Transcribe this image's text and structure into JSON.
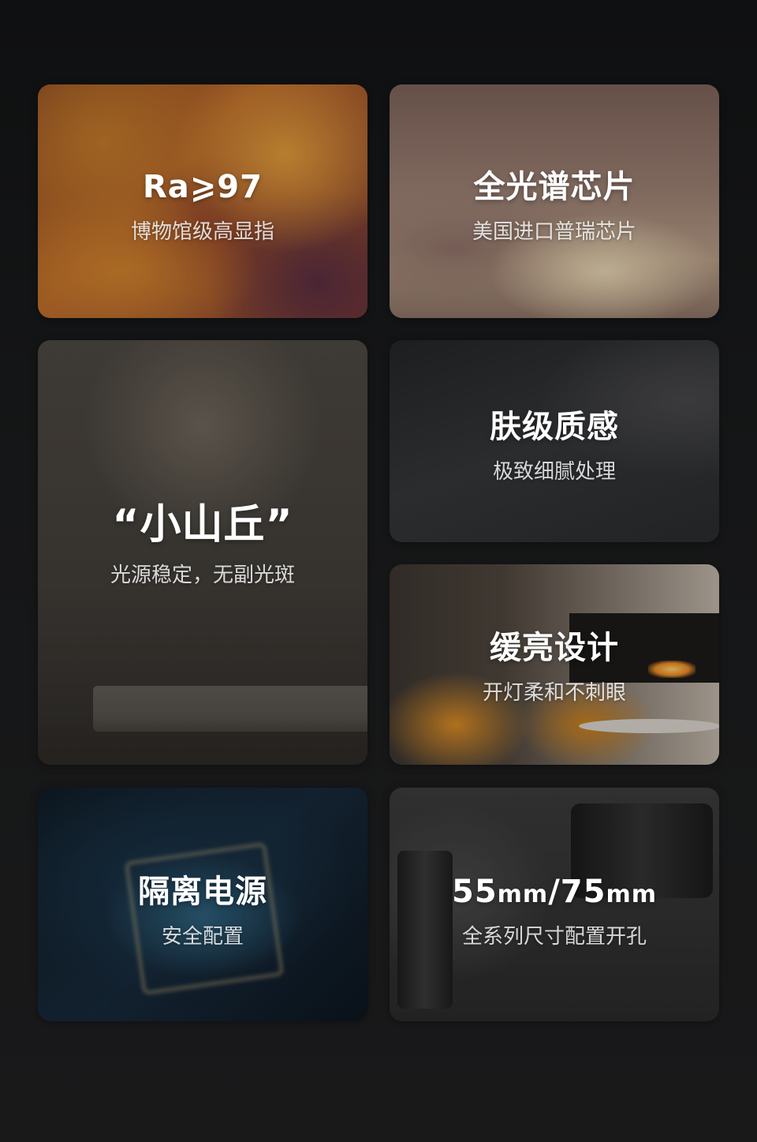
{
  "cards": [
    {
      "title": "Ra⩾97",
      "subtitle": "博物馆级高显指"
    },
    {
      "title": "全光谱芯片",
      "subtitle": "美国进口普瑞芯片"
    },
    {
      "title": "“小山丘”",
      "subtitle": "光源稳定，无副光斑"
    },
    {
      "title": "肤级质感",
      "subtitle": "极致细腻处理"
    },
    {
      "title": "缓亮设计",
      "subtitle": "开灯柔和不刺眼"
    },
    {
      "title": "隔离电源",
      "subtitle": "安全配置"
    },
    {
      "title_parts": [
        "55",
        "mm",
        "/75",
        "mm"
      ],
      "subtitle": "全系列尺寸配置开孔"
    }
  ]
}
